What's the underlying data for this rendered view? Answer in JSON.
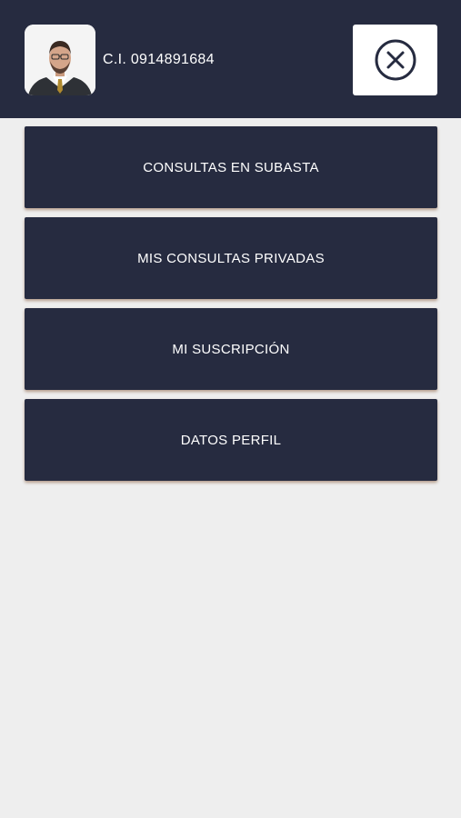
{
  "header": {
    "user_id": "C.I. 0914891684",
    "close_icon": "close-circle-icon"
  },
  "menu": {
    "items": [
      {
        "label": "CONSULTAS EN SUBASTA"
      },
      {
        "label": "MIS CONSULTAS PRIVADAS"
      },
      {
        "label": "MI SUSCRIPCIÓN"
      },
      {
        "label": "DATOS PERFIL"
      }
    ]
  },
  "colors": {
    "header_bg": "#262b40",
    "menu_item_bg": "#262b40",
    "page_bg": "#eeeeee",
    "text": "#ffffff"
  }
}
